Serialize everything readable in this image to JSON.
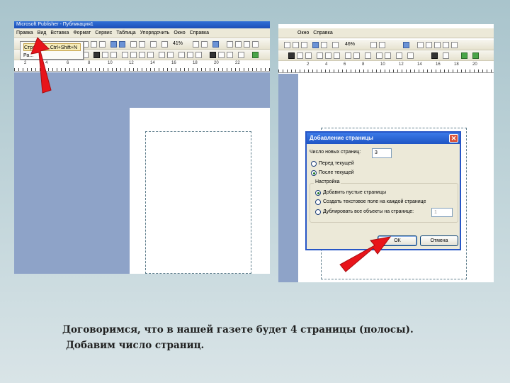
{
  "left_screenshot": {
    "title_bar": "Microsoft Publisher - Публикация1",
    "menu": [
      "Правка",
      "Вид",
      "Вставка",
      "Формат",
      "Сервис",
      "Таблица",
      "Упорядочить",
      "Окно",
      "Справка"
    ],
    "dropdown": {
      "item_label": "Страница...",
      "item_shortcut": "Ctrl+Shift+N",
      "item2_label": "Ра..."
    },
    "zoom": "41%",
    "ruler_labels": [
      "2",
      "4",
      "6",
      "8",
      "10",
      "12",
      "14",
      "16",
      "18",
      "20",
      "22"
    ]
  },
  "right_screenshot": {
    "menu": [
      "Окно",
      "Справка"
    ],
    "zoom": "46%",
    "ruler_labels": [
      "2",
      "4",
      "6",
      "8",
      "10",
      "12",
      "14",
      "16",
      "18",
      "20"
    ],
    "dialog": {
      "title": "Добавление страницы",
      "close_glyph": "✕",
      "pages_count_label": "Число новых страниц:",
      "pages_count_value": "3",
      "radio_before": "Перед текущей",
      "radio_after": "После текущей",
      "settings_group": "Настройка",
      "opt_empty": "Добавить пустые страницы",
      "opt_textbox": "Создать текстовое поле на каждой странице",
      "opt_duplicate": "Дублировать все объекты на странице:",
      "duplicate_page": "1",
      "ok": "ОК",
      "cancel": "Отмена"
    }
  },
  "caption": {
    "line1": "Договоримся, что в нашей газете будет 4 страницы (полосы).",
    "line2": "Добавим число страниц."
  },
  "colors": {
    "background": "#b4cbd2",
    "highlight_arrow": "#e8141a",
    "workspace": "#8ea3c8",
    "dialog_title": "#2756c6"
  }
}
